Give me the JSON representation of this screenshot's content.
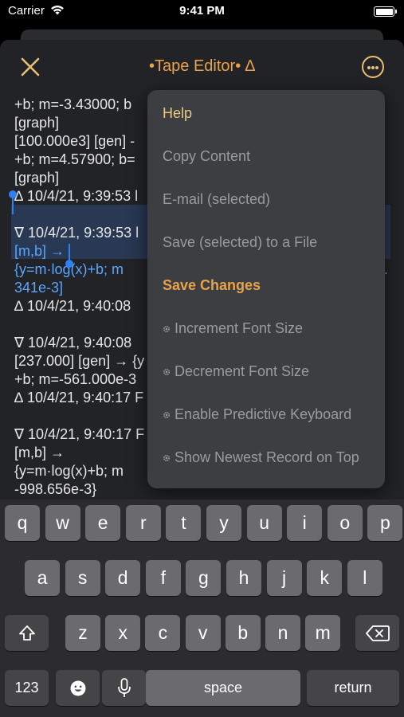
{
  "status_bar": {
    "carrier": "Carrier",
    "time": "9:41 PM"
  },
  "nav": {
    "title": "•Tape Editor• ∆"
  },
  "tape_lines": [
    "+b; m=-3.43000; b",
    "[graph]",
    "[100.000e3] [gen] -",
    "+b; m=4.57900; b=",
    "[graph]",
    "∆ 10/4/21, 9:39:53 l",
    "",
    "∇ 10/4/21, 9:39:53 l",
    "[m,b] →",
    "{y=m·log(x)+b; m",
    "341e-3]",
    "∆ 10/4/21, 9:40:08",
    "",
    "∇ 10/4/21, 9:40:08",
    "[237.000] [gen] → {y",
    "+b; m=-561.000e-3",
    "∆ 10/4/21, 9:40:17 F",
    "",
    "∇ 10/4/21, 9:40:17 F",
    "[m,b] →",
    "{y=m·log(x)+b; m",
    "-998.656e-3}"
  ],
  "tape_extra": {
    "sel_tail": "."
  },
  "menu": {
    "items": [
      {
        "label": "Help",
        "style": "gold"
      },
      {
        "label": "Copy Content",
        "style": "normal"
      },
      {
        "label": "E-mail (selected)",
        "style": "normal"
      },
      {
        "label": "Save (selected) to a File",
        "style": "normal"
      },
      {
        "label": "Save Changes",
        "style": "orange"
      },
      {
        "label": "Increment Font Size",
        "style": "bullet"
      },
      {
        "label": "Decrement Font Size",
        "style": "bullet"
      },
      {
        "label": "Enable Predictive Keyboard",
        "style": "bullet"
      },
      {
        "label": "Show Newest Record on Top",
        "style": "bullet"
      }
    ]
  },
  "keyboard": {
    "row1": [
      "q",
      "w",
      "e",
      "r",
      "t",
      "y",
      "u",
      "i",
      "o",
      "p"
    ],
    "row2": [
      "a",
      "s",
      "d",
      "f",
      "g",
      "h",
      "j",
      "k",
      "l"
    ],
    "row3": [
      "z",
      "x",
      "c",
      "v",
      "b",
      "n",
      "m"
    ],
    "numbers_label": "123",
    "space_label": "space",
    "return_label": "return"
  },
  "icons": {
    "close": "close-icon",
    "more": "ellipsis-circle-icon",
    "shift": "shift-icon",
    "delete": "delete-icon",
    "emoji": "emoji-icon",
    "mic": "microphone-icon",
    "bullet": "gear-bullet-icon"
  },
  "colors": {
    "accent": "#e8a24a",
    "menu_bg": "#3d3e42",
    "selection": "#2f7ff5"
  }
}
